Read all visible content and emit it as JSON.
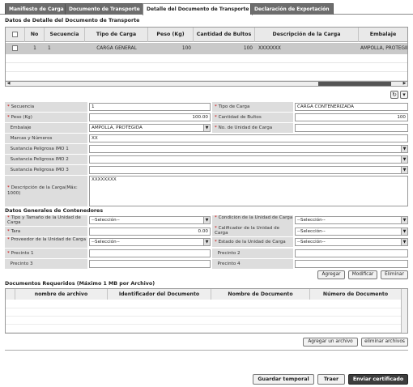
{
  "tabs": [
    {
      "label": "Manifiesto de Carga"
    },
    {
      "label": "Documento de Transporte"
    },
    {
      "label": "Detalle del Documento de Transporte"
    },
    {
      "label": "Declaración de Exportación"
    }
  ],
  "detail_section": {
    "title": "Datos de Detalle del Documento de Transporte",
    "columns": [
      "No",
      "Secuencia",
      "Tipo de Carga",
      "Peso (Kg)",
      "Cantidad de Bultos",
      "Descripción de la Carga",
      "Embalaje"
    ],
    "rows": [
      {
        "no": "1",
        "secuencia": "1",
        "tipo": "CARGA GENERAL",
        "peso": "100",
        "bultos": "100",
        "descripcion": "XXXXXXX",
        "embalaje": "AMPOLLA, PROTEGID"
      }
    ]
  },
  "form": {
    "secuencia_label": "Secuencia",
    "secuencia_value": "1",
    "tipo_carga_label": "Tipo de Carga",
    "tipo_carga_value": "CARGA CONTENERIZADA",
    "peso_label": "Peso (Kg)",
    "peso_value": "100.00",
    "bultos_label": "Cantidad de Bultos",
    "bultos_value": "100",
    "embalaje_label": "Embalaje",
    "embalaje_value": "AMPOLLA, PROTEGIDA",
    "no_unidad_label": "No. de Unidad de Carga",
    "no_unidad_value": "",
    "marcas_label": "Marcas y Números",
    "marcas_value": "XX",
    "imo1_label": "Sustancia Peligrosa IMO 1",
    "imo2_label": "Sustancia Peligrosa IMO 2",
    "imo3_label": "Sustancia Peligrosa IMO 3",
    "descripcion_label": "Descripción de la Carga(Máx: 1000)",
    "descripcion_value": "XXXXXXXX"
  },
  "containers": {
    "title": "Datos Generales de Contenedores",
    "tipo_tamano_label": "Tipo y Tamaño de la Unidad de Carga",
    "tipo_tamano_value": "--Selección--",
    "condicion_label": "Condición de la Unidad de Carga",
    "condicion_value": "--Selección--",
    "tara_label": "Tara",
    "tara_value": "0.00",
    "calificador_label": "Calificador de la Unidad de Carga",
    "calificador_value": "--Selección--",
    "proveedor_label": "Proveedor de la Unidad de Carga",
    "proveedor_value": "--Selección--",
    "estado_label": "Estado de la Unidad de Carga",
    "estado_value": "--Selección--",
    "precinto1_label": "Precinto 1",
    "precinto2_label": "Precinto 2",
    "precinto3_label": "Precinto 3",
    "precinto4_label": "Precinto 4"
  },
  "actions": {
    "agregar": "Agregar",
    "modificar": "Modificar",
    "eliminar": "Eliminar"
  },
  "documents": {
    "title": "Documentos Requeridos (Máximo 1 MB por Archivo)",
    "columns": [
      "nombre de archivo",
      "Identificador del Documento",
      "Nombre de Documento",
      "Número de Documento"
    ],
    "agregar_archivo": "Agregar un archivo",
    "eliminar_archivos": "eliminar archivos"
  },
  "footer": {
    "guardar": "Guardar temporal",
    "traer": "Traer",
    "enviar": "Enviar certificado"
  }
}
